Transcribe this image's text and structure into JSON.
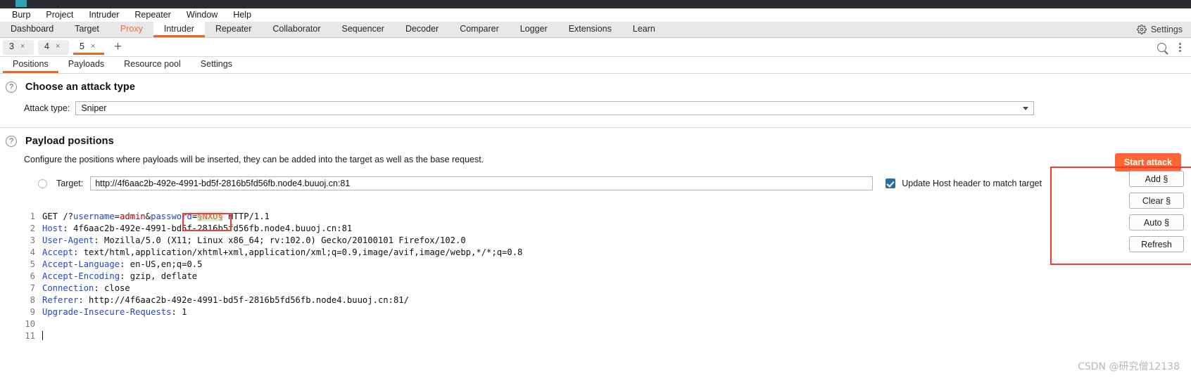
{
  "window": {
    "title_accent_color": "#2ea3b6",
    "titlebar_color": "#2b2b33"
  },
  "menubar": {
    "items": [
      {
        "label": "Burp"
      },
      {
        "label": "Project"
      },
      {
        "label": "Intruder"
      },
      {
        "label": "Repeater"
      },
      {
        "label": "Window"
      },
      {
        "label": "Help"
      }
    ]
  },
  "suite_tabs": {
    "items": [
      {
        "label": "Dashboard",
        "state": "normal"
      },
      {
        "label": "Target",
        "state": "normal"
      },
      {
        "label": "Proxy",
        "state": "highlight"
      },
      {
        "label": "Intruder",
        "state": "active"
      },
      {
        "label": "Repeater",
        "state": "normal"
      },
      {
        "label": "Collaborator",
        "state": "normal"
      },
      {
        "label": "Sequencer",
        "state": "normal"
      },
      {
        "label": "Decoder",
        "state": "normal"
      },
      {
        "label": "Comparer",
        "state": "normal"
      },
      {
        "label": "Logger",
        "state": "normal"
      },
      {
        "label": "Extensions",
        "state": "normal"
      },
      {
        "label": "Learn",
        "state": "normal"
      }
    ],
    "settings_label": "Settings",
    "active_indicator_color": "#f0632b",
    "proxy_color": "#e8703a"
  },
  "attack_tabs": {
    "items": [
      {
        "label": "3",
        "close": "×",
        "active": false
      },
      {
        "label": "4",
        "close": "×",
        "active": false
      },
      {
        "label": "5",
        "close": "×",
        "active": true
      }
    ],
    "new_tab_label": "+"
  },
  "sub_tabs": {
    "items": [
      {
        "label": "Positions",
        "active": true
      },
      {
        "label": "Payloads",
        "active": false
      },
      {
        "label": "Resource pool",
        "active": false
      },
      {
        "label": "Settings",
        "active": false
      }
    ]
  },
  "attack_type_section": {
    "help_icon": "?",
    "title": "Choose an attack type",
    "field_label": "Attack type:",
    "selected_value": "Sniper",
    "start_attack_label": "Start attack",
    "start_attack_color": "#ff6633"
  },
  "payload_positions_section": {
    "help_icon": "?",
    "title": "Payload positions",
    "description": "Configure the positions where payloads will be inserted, they can be added into the target as well as the base request.",
    "target_label": "Target:",
    "target_value": "http://4f6aac2b-492e-4991-bd5f-2816b5fd56fb.node4.buuoj.cn:81",
    "update_host_label": "Update Host header to match target",
    "update_host_checked": true,
    "checkbox_color": "#2b6ca3"
  },
  "request_editor": {
    "lines": [
      {
        "num": "1",
        "text": "GET /?username=admin&password=§NXU§ HTTP/1.1"
      },
      {
        "num": "2",
        "text": "Host: 4f6aac2b-492e-4991-bd5f-2816b5fd56fb.node4.buuoj.cn:81"
      },
      {
        "num": "3",
        "text": "User-Agent: Mozilla/5.0 (X11; Linux x86_64; rv:102.0) Gecko/20100101 Firefox/102.0"
      },
      {
        "num": "4",
        "text": "Accept: text/html,application/xhtml+xml,application/xml;q=0.9,image/avif,image/webp,*/*;q=0.8"
      },
      {
        "num": "5",
        "text": "Accept-Language: en-US,en;q=0.5"
      },
      {
        "num": "6",
        "text": "Accept-Encoding: gzip, deflate"
      },
      {
        "num": "7",
        "text": "Connection: close"
      },
      {
        "num": "8",
        "text": "Referer: http://4f6aac2b-492e-4991-bd5f-2816b5fd56fb.node4.buuoj.cn:81/"
      },
      {
        "num": "9",
        "text": "Upgrade-Insecure-Requests: 1"
      },
      {
        "num": "10",
        "text": ""
      },
      {
        "num": "11",
        "text": ""
      }
    ],
    "payload_marker": "§NXU§",
    "payload_highlight_color": "#d8f2e2",
    "payload_text_color": "#e05a1a"
  },
  "position_buttons": {
    "items": [
      {
        "label": "Add §"
      },
      {
        "label": "Clear §"
      },
      {
        "label": "Auto §"
      },
      {
        "label": "Refresh"
      }
    ]
  },
  "annotations": {
    "color": "#ef3b33",
    "boxes": [
      "payload-marker",
      "position-buttons"
    ]
  },
  "watermark": {
    "text": "CSDN @研究僧12138"
  }
}
